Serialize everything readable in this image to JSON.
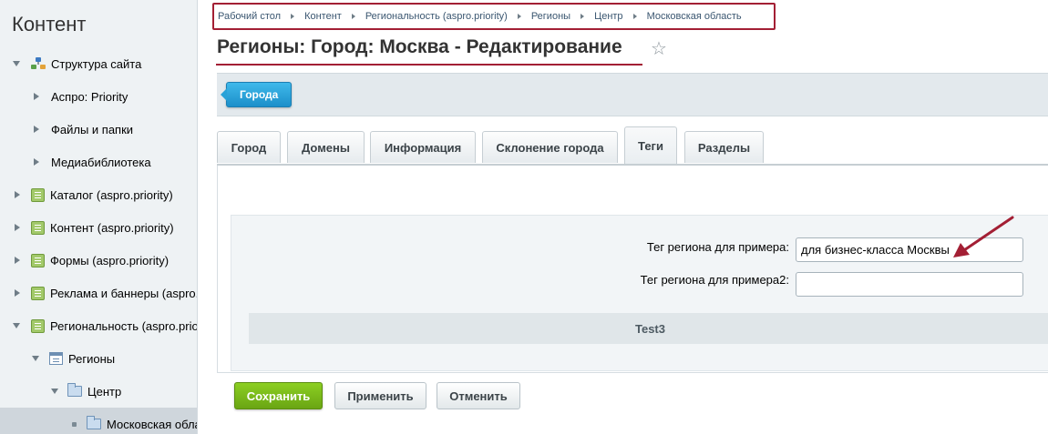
{
  "sidebar": {
    "title": "Контент",
    "items": [
      {
        "label": "Структура сайта"
      },
      {
        "label": "Аспро: Priority"
      },
      {
        "label": "Файлы и папки"
      },
      {
        "label": "Медиабиблиотека"
      },
      {
        "label": "Каталог (aspro.priority)"
      },
      {
        "label": "Контент (aspro.priority)"
      },
      {
        "label": "Формы (aspro.priority)"
      },
      {
        "label": "Реклама и баннеры (aspro.priority)"
      },
      {
        "label": "Региональность (aspro.priority)"
      },
      {
        "label": "Регионы"
      },
      {
        "label": "Центр"
      },
      {
        "label": "Московская область"
      }
    ]
  },
  "breadcrumb": [
    "Рабочий стол",
    "Контент",
    "Региональность (aspro.priority)",
    "Регионы",
    "Центр",
    "Московская область"
  ],
  "page": {
    "title": "Регионы: Город: Москва - Редактирование"
  },
  "toolbar": {
    "cities_button": "Города"
  },
  "tabs": [
    {
      "label": "Город"
    },
    {
      "label": "Домены"
    },
    {
      "label": "Информация"
    },
    {
      "label": "Склонение города"
    },
    {
      "label": "Теги"
    },
    {
      "label": "Разделы"
    }
  ],
  "active_tab": "Теги",
  "form": {
    "tag_example_label": "Тег региона для примера:",
    "tag_example_value": "для бизнес-класса Москвы",
    "tag_example2_label": "Тег региона для примера2:",
    "tag_example2_value": "",
    "section_title": "Test3"
  },
  "buttons": {
    "save": "Сохранить",
    "apply": "Применить",
    "cancel": "Отменить"
  },
  "colors": {
    "highlight": "#a31f34",
    "accent_blue": "#1c8fca",
    "save_green": "#6aa513"
  }
}
